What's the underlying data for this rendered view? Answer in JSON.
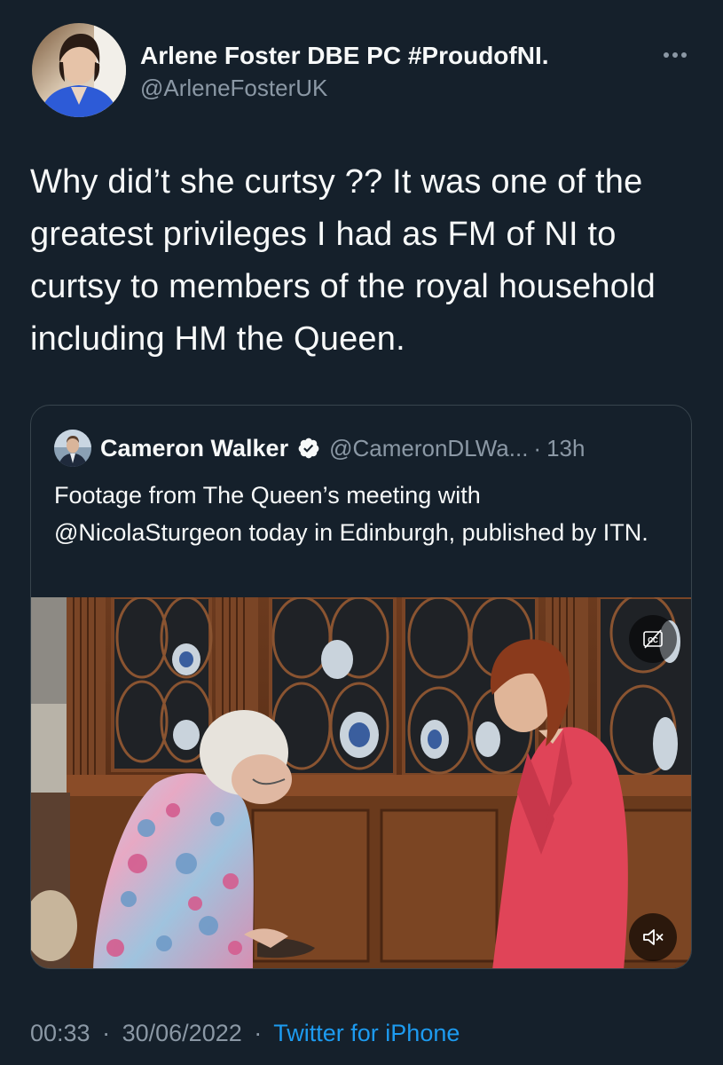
{
  "tweet": {
    "display_name": "Arlene Foster DBE PC #ProudofNI.",
    "handle": "@ArleneFosterUK",
    "more_icon": "more-horizontal-icon",
    "text": "Why did’t she curtsy ?? It was one of the greatest privileges I had as FM of NI to curtsy to members of the royal household including HM the Queen.",
    "time": "00:33",
    "separator": "·",
    "date": "30/06/2022",
    "source": "Twitter for iPhone"
  },
  "quoted_tweet": {
    "display_name": "Cameron Walker",
    "verified_icon": "verified-badge-icon",
    "handle": "@CameronDLWa...",
    "separator": "·",
    "age": "13h",
    "text": "Footage from The Queen’s meeting with @NicolaSturgeon today in Edinburgh, published by ITN.",
    "video": {
      "cc_icon": "captions-icon",
      "mute_icon": "volume-muted-icon"
    }
  },
  "colors": {
    "background": "#15202b",
    "text_primary": "#f7f9f9",
    "text_secondary": "#8b98a5",
    "link": "#1d9bf0",
    "border": "#38444d",
    "verified_badge": "#f7f9f9"
  }
}
